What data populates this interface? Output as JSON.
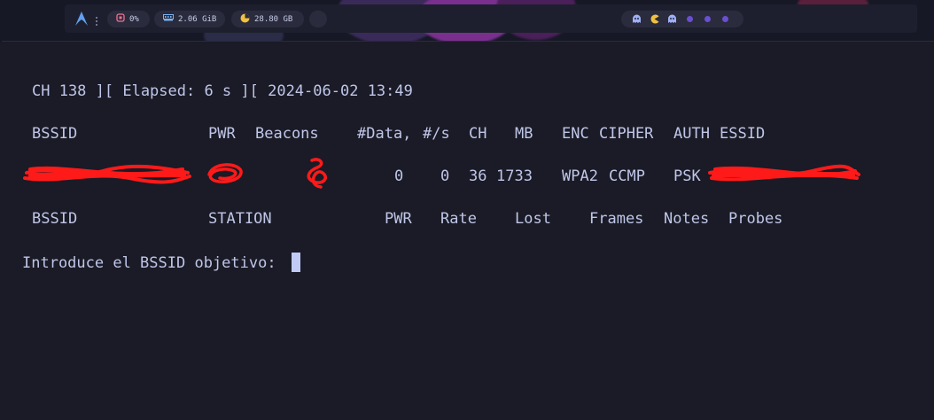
{
  "topbar": {
    "distro_icon": "arch-logo-icon",
    "menu_icon": "vertical-dots-icon",
    "cpu": {
      "icon": "cpu-chip-icon",
      "value": "0%"
    },
    "ram": {
      "icon": "memory-icon",
      "value": "2.06 GiB"
    },
    "disk": {
      "icon": "disk-pie-icon",
      "value": "28.80 GB"
    },
    "workspaces": [
      "ghost-icon",
      "pacman-icon",
      "ghost-icon",
      "dot-icon",
      "dot-icon",
      "dot-icon"
    ]
  },
  "terminal": {
    "status_line": "CH 138 ][ Elapsed: 6 s ][ 2024-06-02 13:49",
    "ap_headers": [
      "BSSID",
      "PWR",
      "Beacons",
      "#Data,",
      "#/s",
      "CH",
      "MB",
      "ENC",
      "CIPHER",
      "AUTH",
      "ESSID"
    ],
    "ap_row": {
      "data": "0",
      "per_s": "0",
      "ch": "36",
      "mb": "1733",
      "enc": "WPA2",
      "cipher": "CCMP",
      "auth": "PSK"
    },
    "station_headers": [
      "BSSID",
      "STATION",
      "PWR",
      "Rate",
      "Lost",
      "Frames",
      "Notes",
      "Probes"
    ],
    "prompt": "Introduce el BSSID objetivo:"
  },
  "colors": {
    "background": "#1a1b26",
    "text": "#c0c6e8",
    "redaction": "#ff1a1a",
    "cursor": "#c0caf5"
  }
}
